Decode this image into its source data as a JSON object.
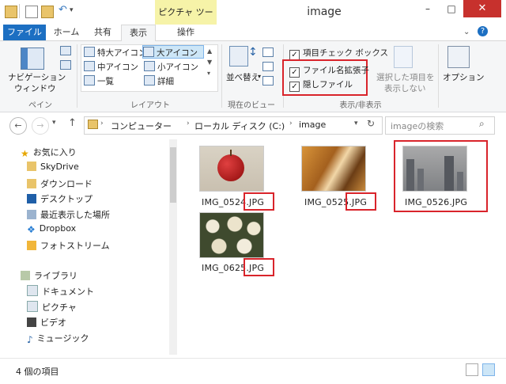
{
  "window": {
    "title": "image",
    "min": "–",
    "max": "□",
    "close": "✕"
  },
  "quick_access": [
    "folder-icon",
    "properties-icon",
    "new-folder-icon",
    "undo-icon"
  ],
  "context_tab": "ピクチャ ツール",
  "tabs": {
    "file": "ファイル",
    "home": "ホーム",
    "share": "共有",
    "view": "表示",
    "manage": "操作"
  },
  "ribbon": {
    "pane": {
      "nav_pane": "ナビゲーション",
      "nav_pane2": "ウィンドウ",
      "group": "ペイン"
    },
    "layout": {
      "items": [
        "特大アイコン",
        "大アイコン",
        "中アイコン",
        "小アイコン",
        "一覧",
        "詳細"
      ],
      "group": "レイアウト"
    },
    "current_view": {
      "sort": "並べ替え",
      "group": "現在のビュー"
    },
    "showhide": {
      "item_checkbox": "項目チェック ボックス",
      "extensions": "ファイル名拡張子",
      "hidden": "隠しファイル",
      "hide_selected": "選択した項目を",
      "hide_selected2": "表示しない",
      "group": "表示/非表示"
    },
    "options": "オプション"
  },
  "address": {
    "crumbs": [
      "コンピューター",
      "ローカル ディスク (C:)",
      "image"
    ],
    "search_placeholder": "imageの検索"
  },
  "nav": {
    "favorites": "お気に入り",
    "fav_items": [
      "SkyDrive",
      "ダウンロード",
      "デスクトップ",
      "最近表示した場所",
      "Dropbox",
      "フォトストリーム"
    ],
    "libraries": "ライブラリ",
    "lib_items": [
      "ドキュメント",
      "ピクチャ",
      "ビデオ",
      "ミュージック"
    ]
  },
  "files": [
    {
      "base": "IMG_0524",
      "ext": ".JPG"
    },
    {
      "base": "IMG_0525",
      "ext": ".JPG"
    },
    {
      "full": "IMG_0526.JPG"
    },
    {
      "base": "IMG_0625",
      "ext": ".JPG"
    }
  ],
  "status": {
    "count": "4 個の項目"
  },
  "colors": {
    "file_tab": "#1c6fc2",
    "close": "#c7312d",
    "highlight": "#d9242b",
    "context": "#f6f3a8"
  }
}
